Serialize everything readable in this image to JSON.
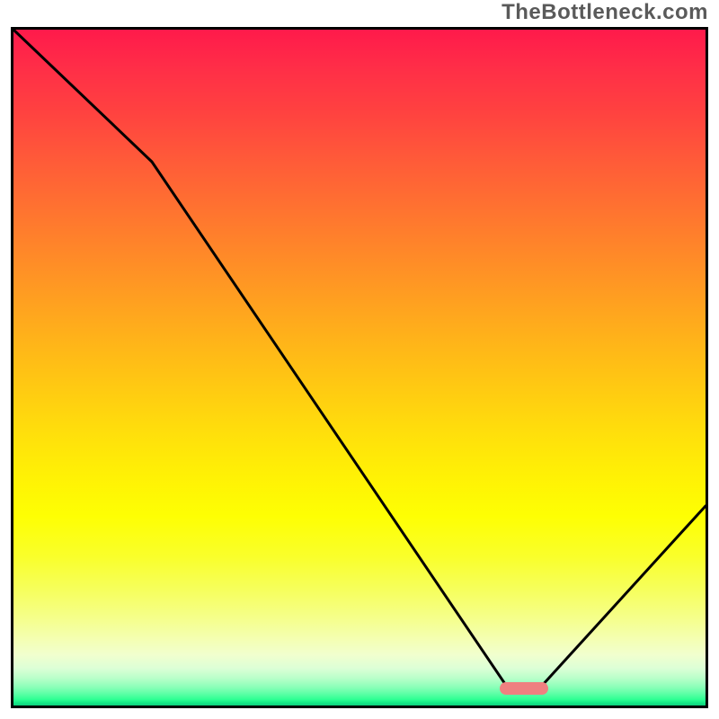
{
  "watermark": "TheBottleneck.com",
  "chart_data": {
    "type": "line",
    "title": "",
    "xlabel": "",
    "ylabel": "",
    "xlim": [
      0,
      100
    ],
    "ylim": [
      0,
      100
    ],
    "series": [
      {
        "name": "curve",
        "x": [
          0,
          20,
          71,
          76,
          100
        ],
        "values": [
          100,
          80.5,
          2.7,
          2.7,
          29.5
        ]
      }
    ],
    "marker": {
      "x_start": 71,
      "x_end": 76,
      "y": 2.7,
      "color": "#ef8080"
    },
    "gradient_stops": [
      {
        "pos": 0.0,
        "color": "#ff1a4b"
      },
      {
        "pos": 0.5,
        "color": "#ffba17"
      },
      {
        "pos": 0.78,
        "color": "#f9ff2b"
      },
      {
        "pos": 0.95,
        "color": "#b8ffc9"
      },
      {
        "pos": 1.0,
        "color": "#0fd07d"
      }
    ]
  }
}
